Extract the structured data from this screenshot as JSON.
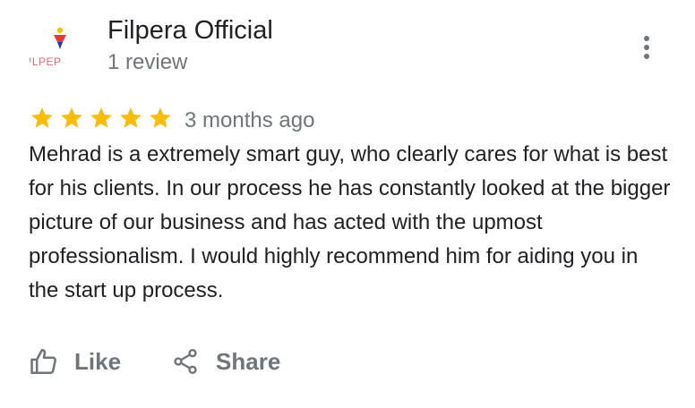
{
  "reviewer": {
    "name": "Filpera Official",
    "review_count": "1 review",
    "avatar_text": "ILPEP",
    "avatar_icon": "filpera-logo",
    "avatar_colors": [
      "#f5c400",
      "#e53935",
      "#1e3aa8"
    ]
  },
  "more_menu": {
    "icon": "more-vert-icon"
  },
  "review": {
    "rating": 5,
    "max_rating": 5,
    "star_color": "#fbbc04",
    "date": "3 months ago",
    "text": "Mehrad is a extremely smart guy, who clearly cares for what is best for his clients. In our process he has constantly looked at the bigger picture of our business and has acted with the upmost professionalism. I would highly recommend him for aiding you in the start up process."
  },
  "actions": {
    "like_label": "Like",
    "like_icon": "thumb-up-icon",
    "share_label": "Share",
    "share_icon": "share-icon"
  }
}
